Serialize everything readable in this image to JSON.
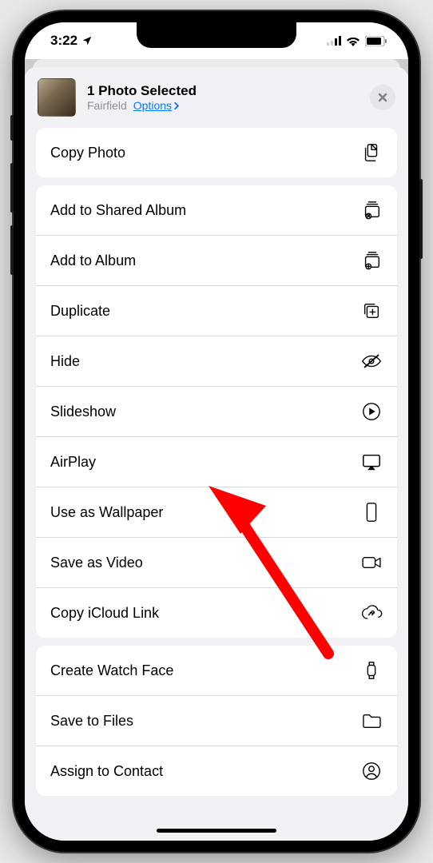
{
  "status": {
    "time": "3:22",
    "location_active": true
  },
  "sheet": {
    "title": "1 Photo Selected",
    "subtitle": "Fairfield",
    "options_label": "Options"
  },
  "groups": [
    {
      "items": [
        {
          "id": "copy-photo",
          "label": "Copy Photo",
          "icon": "copy-doc"
        }
      ]
    },
    {
      "items": [
        {
          "id": "add-shared-album",
          "label": "Add to Shared Album",
          "icon": "shared-album"
        },
        {
          "id": "add-album",
          "label": "Add to Album",
          "icon": "add-album"
        },
        {
          "id": "duplicate",
          "label": "Duplicate",
          "icon": "duplicate"
        },
        {
          "id": "hide",
          "label": "Hide",
          "icon": "eye-slash"
        },
        {
          "id": "slideshow",
          "label": "Slideshow",
          "icon": "play-circle"
        },
        {
          "id": "airplay",
          "label": "AirPlay",
          "icon": "airplay"
        },
        {
          "id": "wallpaper",
          "label": "Use as Wallpaper",
          "icon": "phone-rect"
        },
        {
          "id": "save-video",
          "label": "Save as Video",
          "icon": "video-cam"
        },
        {
          "id": "icloud-link",
          "label": "Copy iCloud Link",
          "icon": "cloud-link"
        }
      ]
    },
    {
      "items": [
        {
          "id": "watch-face",
          "label": "Create Watch Face",
          "icon": "watch"
        },
        {
          "id": "save-files",
          "label": "Save to Files",
          "icon": "folder"
        },
        {
          "id": "assign-contact",
          "label": "Assign to Contact",
          "icon": "contact"
        }
      ]
    }
  ]
}
